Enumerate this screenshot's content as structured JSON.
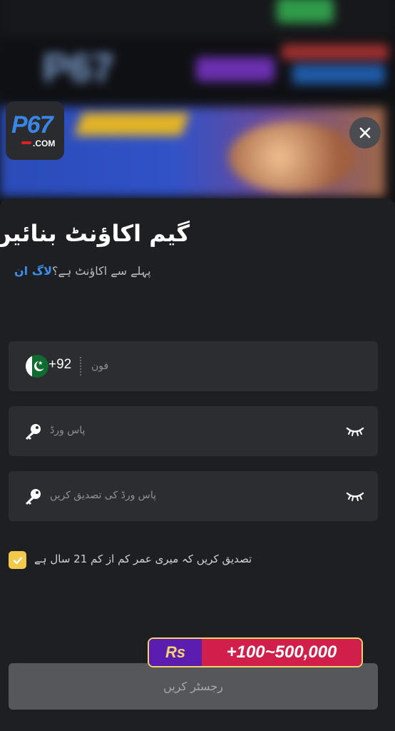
{
  "brand": {
    "logo_main": "P67",
    "logo_sub": ".COM"
  },
  "modal": {
    "title": "گیم اکاؤنٹ بنائیں",
    "subtitle_prefix": "پہلے سے اکاؤنٹ ہے؟",
    "login_link": "لاگ ان"
  },
  "phone": {
    "country_code": "+92",
    "placeholder": "فون",
    "flag": "pakistan-flag"
  },
  "password": {
    "placeholder": "پاس ورڈ"
  },
  "confirm_password": {
    "placeholder": "پاس ورڈ کی تصدیق کریں"
  },
  "age_check": {
    "label": "تصدیق کریں کہ میری عمر کم از کم 21 سال ہے",
    "checked": true
  },
  "register_button": {
    "label": "رجسٹر کریں"
  },
  "promo": {
    "currency": "Rs",
    "amount": "+100~500,000"
  },
  "colors": {
    "accent": "#3b8eea",
    "checkbox": "#f2c94c",
    "promo_red": "#d01f4a",
    "promo_purple": "#5a1db0"
  }
}
